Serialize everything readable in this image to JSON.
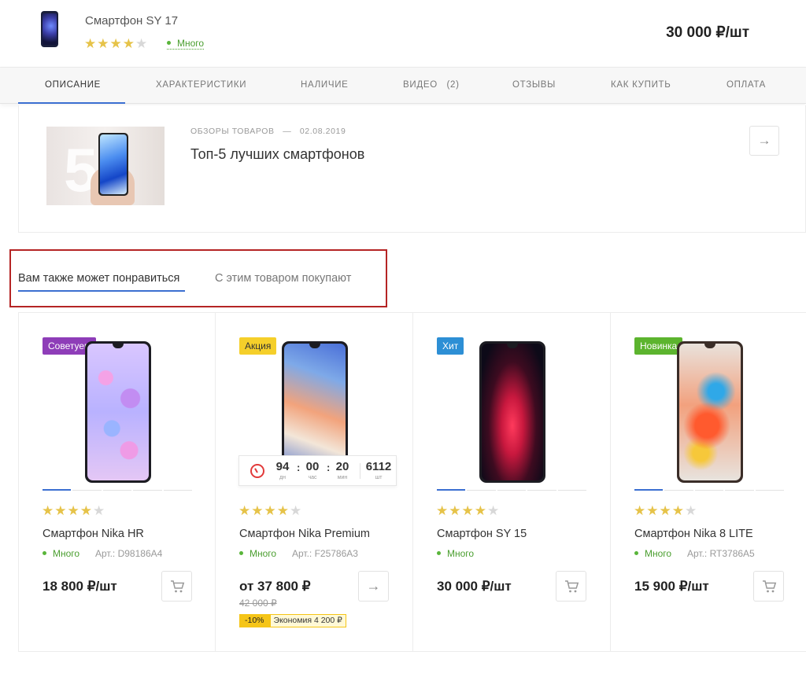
{
  "top": {
    "product_title": "Смартфон SY 17",
    "rating": 4,
    "stars": [
      "★",
      "★",
      "★",
      "★",
      "★"
    ],
    "stock": "Много",
    "price": "30 000 ₽/шт"
  },
  "tabs": [
    "ОПИСАНИЕ",
    "ХАРАКТЕРИСТИКИ",
    "НАЛИЧИЕ",
    "ВИДЕО   (2)",
    "ОТЗЫВЫ",
    "КАК КУПИТЬ",
    "ОПЛАТА"
  ],
  "active_tab": "ОПИСАНИЕ",
  "article": {
    "meta": "ОБЗОРЫ ТОВАРОВ   —   02.08.2019",
    "title": "Топ-5 лучших смартфонов",
    "image_text": "5",
    "arrow": "→"
  },
  "recommend_tabs": {
    "active": "Вам также может понравиться",
    "inactive": "С этим товаром покупают"
  },
  "products": [
    {
      "badge": "Советуем",
      "badge_color": "#8e3db8",
      "name": "Смартфон Nika HR",
      "rating": 4,
      "stock": "Много",
      "article": "Арт.: D98186A4",
      "price": "18 800 ₽/шт",
      "action": "cart-icon"
    },
    {
      "badge": "Акция",
      "badge_color": "#f5cf2a",
      "name": "Смартфон Nika Premium",
      "rating": 4,
      "stock": "Много",
      "article": "Арт.: F25786A3",
      "price": "от 37 800 ₽",
      "old_price": "42 000 ₽",
      "discount": "-10%",
      "saving": "Экономия 4 200 ₽",
      "timer": {
        "days": "94",
        "days_label": "дн",
        "hours": "00",
        "hours_label": "час",
        "minutes": "20",
        "minutes_label": "мин",
        "count": "6112",
        "count_label": "шт"
      },
      "action": "arrow-right-icon"
    },
    {
      "badge": "Хит",
      "badge_color": "#2d8fd5",
      "name": "Смартфон SY 15",
      "rating": 4,
      "stock": "Много",
      "article": "",
      "price": "30 000 ₽/шт",
      "action": "cart-icon"
    },
    {
      "badge": "Новинка",
      "badge_color": "#5cb42e",
      "name": "Смартфон Nika 8 LITE",
      "rating": 4,
      "stock": "Много",
      "article": "Арт.: RT3786A5",
      "price": "15 900 ₽/шт",
      "action": "cart-icon"
    }
  ],
  "colors": {
    "accent": "#3b6fd1",
    "stock_green": "#59b53a",
    "star": "#e6c349",
    "highlight_frame": "#b52424"
  }
}
